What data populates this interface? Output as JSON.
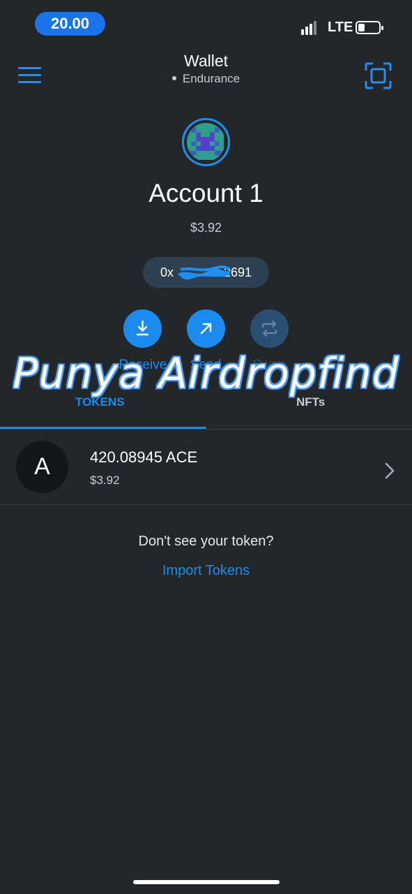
{
  "status_bar": {
    "time": "20.00",
    "network_type": "LTE"
  },
  "header": {
    "title": "Wallet",
    "network": "Endurance",
    "menu_icon": "hamburger-icon",
    "scan_icon": "qr-scan-icon"
  },
  "account": {
    "name": "Account 1",
    "balance": "$3.92",
    "address": "0x        2691"
  },
  "actions": [
    {
      "label": "Receive",
      "icon": "download-icon"
    },
    {
      "label": "Send",
      "icon": "arrow-up-right-icon"
    },
    {
      "label": "Swap",
      "icon": "swap-icon"
    }
  ],
  "tabs": [
    {
      "label": "TOKENS"
    },
    {
      "label": "NFTs"
    }
  ],
  "watermark": "Punya Airdropfind",
  "tokens": [
    {
      "symbol_initial": "A",
      "amount": "420.08945 ACE",
      "value": "$3.92"
    }
  ],
  "import": {
    "prompt": "Don't see your token?",
    "link": "Import Tokens"
  },
  "colors": {
    "background": "#24272a",
    "accent": "#1c8bf0",
    "disabled": "#2a4f72"
  }
}
